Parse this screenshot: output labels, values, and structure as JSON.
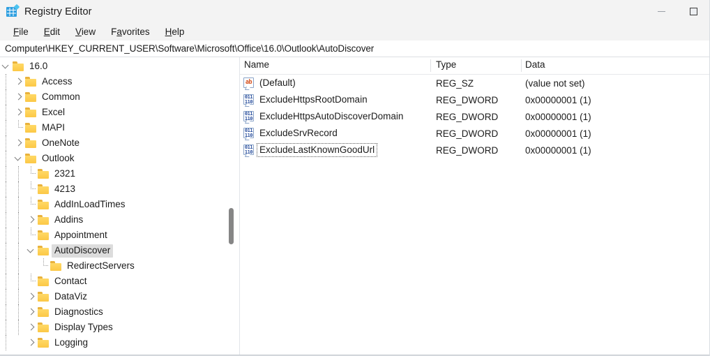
{
  "window": {
    "title": "Registry Editor",
    "icon": "registry-editor-icon",
    "controls": {
      "minimize": "minimize-icon",
      "maximize": "maximize-icon"
    }
  },
  "menubar": {
    "items": [
      {
        "label": "File",
        "accel_index": 0
      },
      {
        "label": "Edit",
        "accel_index": 0
      },
      {
        "label": "View",
        "accel_index": 0
      },
      {
        "label": "Favorites",
        "accel_index": 1
      },
      {
        "label": "Help",
        "accel_index": 0
      }
    ]
  },
  "address": {
    "path": "Computer\\HKEY_CURRENT_USER\\Software\\Microsoft\\Office\\16.0\\Outlook\\AutoDiscover"
  },
  "tree": {
    "items": [
      {
        "label": "16.0",
        "depth": 0,
        "state": "expanded",
        "selected": false
      },
      {
        "label": "Access",
        "depth": 1,
        "state": "collapsed",
        "selected": false
      },
      {
        "label": "Common",
        "depth": 1,
        "state": "collapsed",
        "selected": false
      },
      {
        "label": "Excel",
        "depth": 1,
        "state": "collapsed",
        "selected": false
      },
      {
        "label": "MAPI",
        "depth": 1,
        "state": "leaf",
        "selected": false
      },
      {
        "label": "OneNote",
        "depth": 1,
        "state": "collapsed",
        "selected": false
      },
      {
        "label": "Outlook",
        "depth": 1,
        "state": "expanded",
        "selected": false
      },
      {
        "label": "2321",
        "depth": 2,
        "state": "leaf",
        "selected": false
      },
      {
        "label": "4213",
        "depth": 2,
        "state": "leaf",
        "selected": false
      },
      {
        "label": "AddInLoadTimes",
        "depth": 2,
        "state": "leaf",
        "selected": false
      },
      {
        "label": "Addins",
        "depth": 2,
        "state": "collapsed",
        "selected": false
      },
      {
        "label": "Appointment",
        "depth": 2,
        "state": "leaf",
        "selected": false
      },
      {
        "label": "AutoDiscover",
        "depth": 2,
        "state": "expanded",
        "selected": true
      },
      {
        "label": "RedirectServers",
        "depth": 3,
        "state": "leaf",
        "selected": false
      },
      {
        "label": "Contact",
        "depth": 2,
        "state": "leaf",
        "selected": false
      },
      {
        "label": "DataViz",
        "depth": 2,
        "state": "collapsed",
        "selected": false
      },
      {
        "label": "Diagnostics",
        "depth": 2,
        "state": "collapsed",
        "selected": false
      },
      {
        "label": "Display Types",
        "depth": 2,
        "state": "collapsed",
        "selected": false
      },
      {
        "label": "Logging",
        "depth": 2,
        "state": "collapsed",
        "selected": false
      }
    ]
  },
  "values": {
    "columns": [
      "Name",
      "Type",
      "Data"
    ],
    "rows": [
      {
        "icon": "string-value-icon",
        "icon_glyph": "ab",
        "name": "(Default)",
        "type": "REG_SZ",
        "data": "(value not set)",
        "focused": false
      },
      {
        "icon": "dword-value-icon",
        "icon_glyph": "011\n110",
        "name": "ExcludeHttpsRootDomain",
        "type": "REG_DWORD",
        "data": "0x00000001 (1)",
        "focused": false
      },
      {
        "icon": "dword-value-icon",
        "icon_glyph": "011\n110",
        "name": "ExcludeHttpsAutoDiscoverDomain",
        "type": "REG_DWORD",
        "data": "0x00000001 (1)",
        "focused": false
      },
      {
        "icon": "dword-value-icon",
        "icon_glyph": "011\n110",
        "name": "ExcludeSrvRecord",
        "type": "REG_DWORD",
        "data": "0x00000001 (1)",
        "focused": false
      },
      {
        "icon": "dword-value-icon",
        "icon_glyph": "011\n110",
        "name": "ExcludeLastKnownGoodUrl",
        "type": "REG_DWORD",
        "data": "0x00000001 (1)",
        "focused": true
      }
    ]
  },
  "colors": {
    "chrome": "#f3f3f3",
    "folder": "#ffd25e",
    "selection": "#dcdcdc",
    "accent": "#2f9fe0",
    "string_icon": "#d5521f",
    "dword_icon": "#2a4f9e"
  }
}
